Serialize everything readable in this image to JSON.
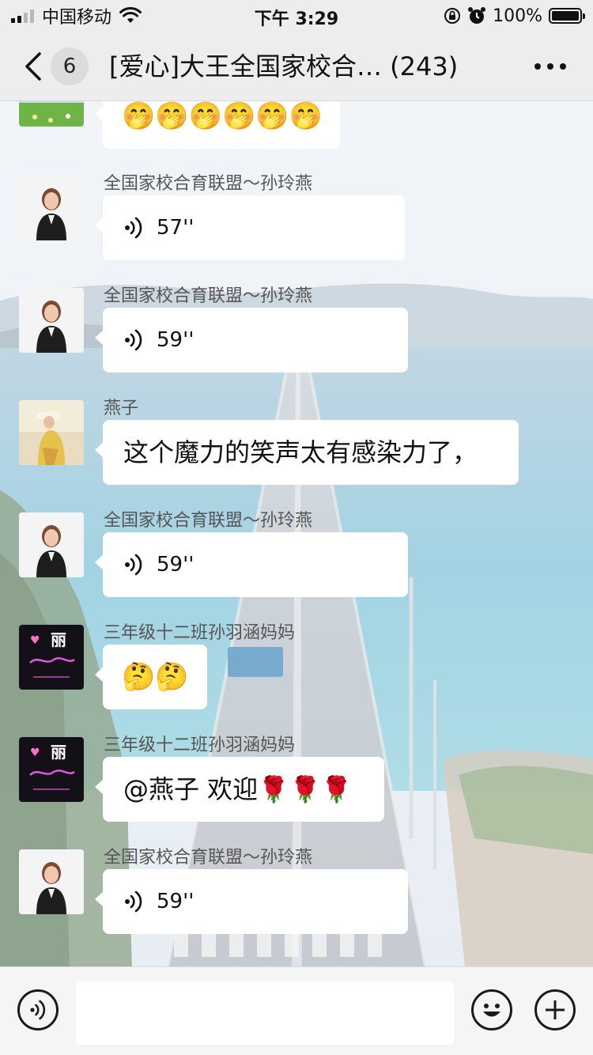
{
  "status_bar": {
    "carrier": "中国移动",
    "time": "下午 3:29",
    "battery": "100%"
  },
  "nav": {
    "unread_count": "6",
    "title": "[爱心]大王全国家校合… (243)"
  },
  "messages": [
    {
      "type": "emoji",
      "sender": "",
      "content": "🤭🤭🤭🤭🤭🤭"
    },
    {
      "type": "voice",
      "sender": "全国家校合育联盟～孙玲燕",
      "duration": "57''"
    },
    {
      "type": "voice",
      "sender": "全国家校合育联盟～孙玲燕",
      "duration": "59''"
    },
    {
      "type": "text",
      "sender": "燕子",
      "content": "这个魔力的笑声太有感染力了，"
    },
    {
      "type": "voice",
      "sender": "全国家校合育联盟～孙玲燕",
      "duration": "59''"
    },
    {
      "type": "emoji",
      "sender": "三年级十二班孙羽涵妈妈",
      "content": "🤔🤔"
    },
    {
      "type": "text",
      "sender": "三年级十二班孙羽涵妈妈",
      "content": "@燕子 欢迎🌹🌹🌹"
    },
    {
      "type": "voice",
      "sender": "全国家校合育联盟～孙玲燕",
      "duration": "59''"
    }
  ],
  "avatar_text": {
    "li": "丽"
  },
  "icons": {
    "back": "chevron-left-icon",
    "more": "more-dots-icon",
    "voice_message": "voice-wave-icon",
    "voice_input": "voice-input-icon",
    "emoji": "emoji-icon",
    "plus": "plus-icon",
    "wifi": "wifi-icon",
    "alarm": "alarm-clock-icon",
    "rotation_lock": "rotation-lock-icon"
  },
  "colors": {
    "nav_bg": "#ededed",
    "bubble_bg": "#ffffff",
    "input_bar_bg": "#f5f5f5"
  }
}
